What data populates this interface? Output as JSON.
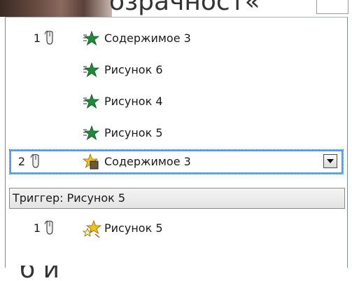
{
  "slide": {
    "top_text": "озрачност«",
    "bottom_text": "б    й"
  },
  "animation_pane": {
    "items": [
      {
        "step": "1",
        "label": "Содержимое 3",
        "effect_icon": "green-star-entrance-icon",
        "show_mouse": true
      },
      {
        "step": "",
        "label": "Рисунок 6",
        "effect_icon": "green-star-entrance-icon",
        "show_mouse": false
      },
      {
        "step": "",
        "label": "Рисунок 4",
        "effect_icon": "green-star-entrance-icon",
        "show_mouse": false
      },
      {
        "step": "",
        "label": "Рисунок 5",
        "effect_icon": "green-star-entrance-icon",
        "show_mouse": false
      },
      {
        "step": "2",
        "label": "Содержимое 3",
        "effect_icon": "yellow-star-emphasis-icon",
        "show_mouse": true,
        "selected": true
      }
    ],
    "trigger_label": "Триггер: Рисунок 5",
    "trigger_items": [
      {
        "step": "1",
        "label": "Рисунок 5",
        "effect_icon": "yellow-stars-emphasis-icon",
        "show_mouse": true
      }
    ]
  },
  "colors": {
    "entrance_green": "#1e8a3a",
    "emphasis_yellow": "#f2c21a",
    "selection_blue": "#5c9ae6"
  }
}
